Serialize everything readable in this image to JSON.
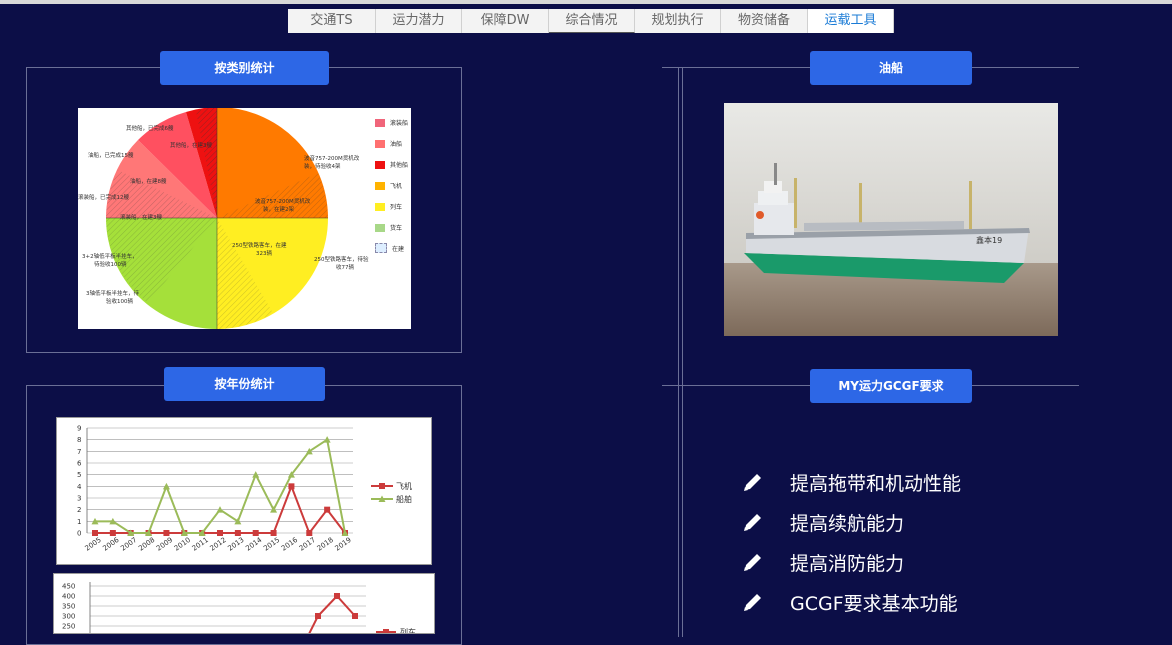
{
  "tabs": [
    {
      "label": "交通TS",
      "active": false
    },
    {
      "label": "运力潜力",
      "active": false
    },
    {
      "label": "保障DW",
      "active": false
    },
    {
      "label": "综合情况",
      "active": false
    },
    {
      "label": "规划执行",
      "active": false
    },
    {
      "label": "物资储备",
      "active": false
    },
    {
      "label": "运载工具",
      "active": true
    }
  ],
  "panels": {
    "by_category": {
      "title": "按类别统计"
    },
    "by_year": {
      "title": "按年份统计"
    },
    "tanker": {
      "title": "油船"
    },
    "requirements": {
      "title": "MY运力GCGF要求"
    }
  },
  "pie_chart": {
    "legend": [
      {
        "label": "滚装船",
        "color": "#f0657a"
      },
      {
        "label": "油船",
        "color": "#ff7070"
      },
      {
        "label": "其他船",
        "color": "#ee1111"
      },
      {
        "label": "飞机",
        "color": "#ffb300"
      },
      {
        "label": "列车",
        "color": "#ffee22"
      },
      {
        "label": "货车",
        "color": "#a8d888"
      },
      {
        "label": "在建",
        "color": "#ddeeff"
      }
    ],
    "annotations": [
      "其他船，已完成6艘",
      "其他船，在建3艘",
      "油船，已完成15艘",
      "油船，在建8艘",
      "滚装船，已完成12艘",
      "滚装船，在建3艘",
      "波音757-200M货机改装，待验收4架",
      "波音757-200M货机改装，在建2架",
      "250型铁路客车，在建323辆",
      "250型铁路客车，待验收77辆",
      "3+2轴低平板半挂车，待验收100辆",
      "3轴低平板半挂车，待验收100辆"
    ]
  },
  "chart_data": [
    {
      "type": "line",
      "x": [
        "2005",
        "2006",
        "2007",
        "2008",
        "2009",
        "2010",
        "2011",
        "2012",
        "2013",
        "2014",
        "2015",
        "2016",
        "2017",
        "2018",
        "2019"
      ],
      "ylim": [
        0,
        9
      ],
      "series": [
        {
          "name": "飞机",
          "color": "#cc3b3b",
          "values": [
            0,
            0,
            0,
            0,
            0,
            0,
            0,
            0,
            0,
            0,
            0,
            4,
            0,
            2,
            0
          ]
        },
        {
          "name": "船舶",
          "color": "#9bbb59",
          "values": [
            1,
            1,
            0,
            0,
            4,
            0,
            0,
            2,
            1,
            5,
            2,
            5,
            7,
            8,
            0
          ]
        }
      ]
    },
    {
      "type": "line",
      "yticks": [
        "450",
        "400",
        "350",
        "300",
        "250"
      ],
      "series": [
        {
          "name": "列车",
          "color": "#cc3b3b",
          "values": [
            300,
            400,
            300
          ]
        }
      ]
    }
  ],
  "requirements": [
    "提高拖带和机动性能",
    "提高续航能力",
    "提高消防能力",
    "GCGF要求基本功能"
  ],
  "ship_name": "鑫本19"
}
